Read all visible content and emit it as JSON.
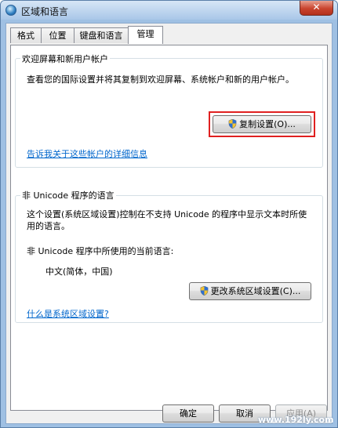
{
  "window": {
    "title": "区域和语言",
    "close_symbol": "✕"
  },
  "tabs": [
    {
      "label": "格式",
      "active": false
    },
    {
      "label": "位置",
      "active": false
    },
    {
      "label": "键盘和语言",
      "active": false
    },
    {
      "label": "管理",
      "active": true
    }
  ],
  "welcome_group": {
    "title": "欢迎屏幕和新用户帐户",
    "description": "查看您的国际设置并将其复制到欢迎屏幕、系统帐户和新的用户帐户。",
    "copy_button": "复制设置(O)...",
    "link": "告诉我关于这些帐户的详细信息"
  },
  "unicode_group": {
    "title": "非 Unicode 程序的语言",
    "description_line1": "这个设置(系统区域设置)控制在不支持 Unicode 的程序中显示文本时所使",
    "description_line2": "用的语言。",
    "current_label": "非 Unicode 程序中所使用的当前语言:",
    "current_value": "中文(简体，中国)",
    "change_button": "更改系统区域设置(C)...",
    "link": "什么是系统区域设置?"
  },
  "footer": {
    "ok": "确定",
    "cancel": "取消",
    "apply": "应用(A)"
  },
  "watermark": "www.192ly.com",
  "colors": {
    "link": "#0066cc",
    "highlight": "#e02020",
    "frame": "#9fc0e3"
  }
}
